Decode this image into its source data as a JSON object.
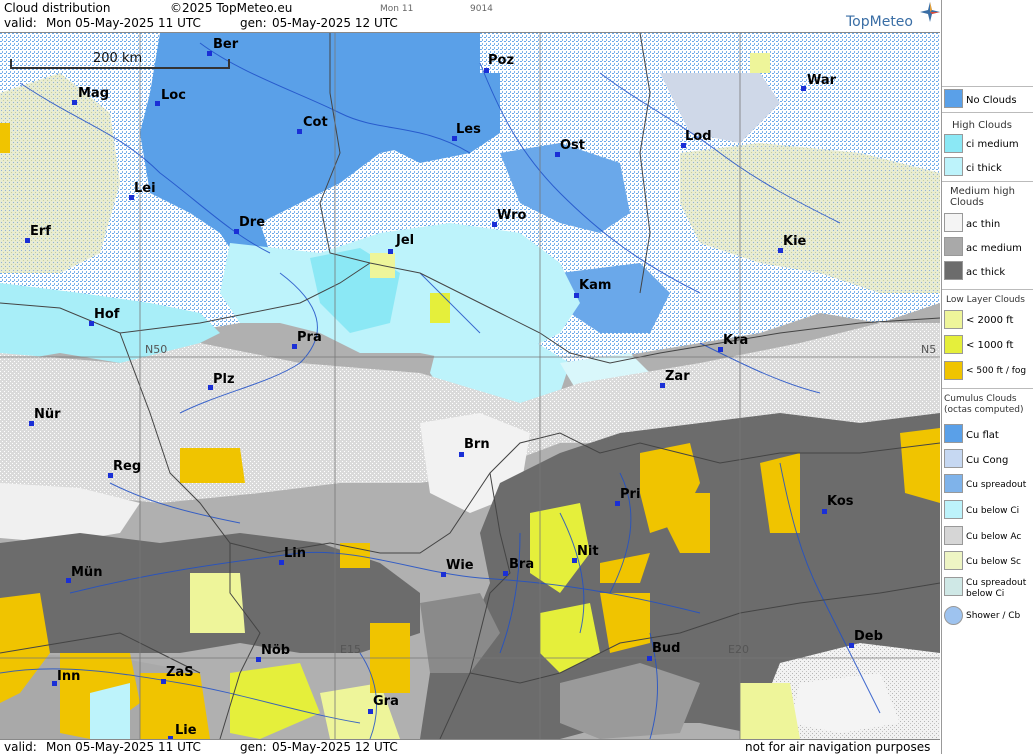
{
  "header": {
    "title": "Cloud distribution",
    "copyright": "©2025 TopMeteo.eu",
    "run_label": "Mon 11",
    "code": "9014",
    "valid_label": "valid:",
    "valid_value": "Mon  05-May-2025  11 UTC",
    "gen_label": "gen:",
    "gen_value": "05-May-2025 12 UTC",
    "logo": "TopMeteo"
  },
  "footer": {
    "valid_label": "valid:",
    "valid_value": "Mon  05-May-2025  11 UTC",
    "gen_label": "gen:",
    "gen_value": "05-May-2025 12 UTC",
    "disclaimer": "not for air navigation purposes"
  },
  "map": {
    "scale_label": "200 km",
    "grid_labels": [
      "N50",
      "N5",
      "E15",
      "E20"
    ],
    "cities": [
      {
        "name": "Ber"
      },
      {
        "name": "Poz"
      },
      {
        "name": "War"
      },
      {
        "name": "Mag"
      },
      {
        "name": "Loc"
      },
      {
        "name": "Cot"
      },
      {
        "name": "Les"
      },
      {
        "name": "Ost"
      },
      {
        "name": "Lod"
      },
      {
        "name": "Lei"
      },
      {
        "name": "Dre"
      },
      {
        "name": "Wro"
      },
      {
        "name": "Erf"
      },
      {
        "name": "Jel"
      },
      {
        "name": "Kie"
      },
      {
        "name": "Kam"
      },
      {
        "name": "Hof"
      },
      {
        "name": "Pra"
      },
      {
        "name": "Kra"
      },
      {
        "name": "Zar"
      },
      {
        "name": "Plz"
      },
      {
        "name": "Nür"
      },
      {
        "name": "Brn"
      },
      {
        "name": "Reg"
      },
      {
        "name": "Pri"
      },
      {
        "name": "Kos"
      },
      {
        "name": "Lin"
      },
      {
        "name": "Nit"
      },
      {
        "name": "Mün"
      },
      {
        "name": "Wie"
      },
      {
        "name": "Bra"
      },
      {
        "name": "Bud"
      },
      {
        "name": "Deb"
      },
      {
        "name": "Inn"
      },
      {
        "name": "ZaS"
      },
      {
        "name": "Nöb"
      },
      {
        "name": "Gra"
      },
      {
        "name": "Lie"
      }
    ]
  },
  "legend": {
    "items": [
      {
        "label": "No Clouds",
        "color": "#5aa0e8"
      },
      {
        "head": "High Clouds"
      },
      {
        "label": "ci medium",
        "color": "#8be8f5"
      },
      {
        "label": "ci thick",
        "color": "#bdf3fb"
      },
      {
        "head": "Medium high Clouds"
      },
      {
        "label": "ac thin",
        "color": "#f4f4f4"
      },
      {
        "label": "ac medium",
        "color": "#a9a9a9"
      },
      {
        "label": "ac thick",
        "color": "#6c6c6c"
      },
      {
        "head": "Low Layer Clouds"
      },
      {
        "label": "< 2000 ft",
        "color": "#eef59a"
      },
      {
        "label": "< 1000 ft",
        "color": "#e5ef3b"
      },
      {
        "label": "< 500 ft / fog",
        "color": "#f0c400"
      },
      {
        "head": "Cumulus Clouds (octas computed)"
      },
      {
        "label": "Cu flat",
        "color": "#5aa0e8"
      },
      {
        "label": "Cu Cong",
        "color": "#c6d8f2"
      },
      {
        "label": "Cu spreadout",
        "color": "#7fb3ea"
      },
      {
        "label": "Cu below Ci",
        "color": "#bdf3fb"
      },
      {
        "label": "Cu below Ac",
        "color": "#d6d6d6"
      },
      {
        "label": "Cu below Sc",
        "color": "#eef5c4"
      },
      {
        "label": "Cu spreadout below Ci",
        "color": "#cfe8e6"
      },
      {
        "label": "Shower / Cb",
        "color": "#9ec3ef"
      }
    ]
  }
}
